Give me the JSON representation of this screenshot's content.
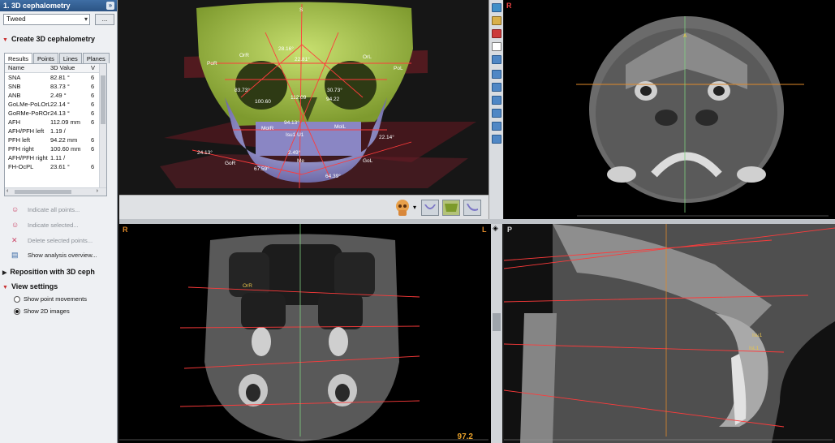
{
  "panel": {
    "title": "1. 3D cephalometry",
    "collapse_icon": "double-chevron-up",
    "analysis_select": "Tweed",
    "more_button": "...",
    "section_create": "Create 3D cephalometry",
    "tabs": [
      "Results",
      "Points",
      "Lines",
      "Planes"
    ],
    "active_tab": "Results",
    "table": {
      "headers": [
        "Name",
        "3D Value",
        "V"
      ],
      "rows": [
        {
          "name": "SNA",
          "value": "82.81 °",
          "v": "6"
        },
        {
          "name": "SNB",
          "value": "83.73 °",
          "v": "6"
        },
        {
          "name": "ANB",
          "value": "2.49 °",
          "v": "6"
        },
        {
          "name": "GoLMe-PoLOrL",
          "value": "22.14 °",
          "v": "6"
        },
        {
          "name": "GoRMe-PoROrR",
          "value": "24.13 °",
          "v": "6"
        },
        {
          "name": "AFH",
          "value": "112.09 mm",
          "v": "6"
        },
        {
          "name": "AFH/PFH left",
          "value": "1.19 /",
          "v": ""
        },
        {
          "name": "PFH left",
          "value": "94.22 mm",
          "v": "6"
        },
        {
          "name": "PFH right",
          "value": "100.60 mm",
          "v": "6"
        },
        {
          "name": "AFH/PFH right",
          "value": "1.11 /",
          "v": ""
        },
        {
          "name": "FH-OcPL",
          "value": "23.61 °",
          "v": "6"
        }
      ]
    },
    "actions": {
      "indicate_all": "Indicate all points...",
      "indicate_selected": "Indicate selected...",
      "delete_selected": "Delete selected points...",
      "show_overview": "Show analysis overview..."
    },
    "section_reposition": "Reposition with 3D ceph",
    "section_view": "View settings",
    "radio_point_movements": "Show point movements",
    "radio_2d_images": "Show 2D images",
    "radio_selected": "Show 2D images"
  },
  "view3d": {
    "labels": {
      "porL": "PoR",
      "orR": "OrR",
      "orL": "OrL",
      "poL": "PoL",
      "s": "S",
      "n": "N",
      "m": "28.16°",
      "a": "22.81°",
      "c": "83.73°",
      "d": "30.73°",
      "e": "100.60",
      "f": "112.09",
      "g": "94.22",
      "h": "94.13°",
      "molR": "MolR",
      "molL": "MolL",
      "isup": "Isu1 U1",
      "ang1": "24.13°",
      "ang2": "22.14°",
      "ang3": "2.49°",
      "goR": "GoR",
      "goL": "GoL",
      "ang4": "67.59°",
      "ang5": "64.39°",
      "me": "Me"
    }
  },
  "axial": {
    "orientation": "R",
    "point_a": "A"
  },
  "coronal": {
    "left_label": "R",
    "right_label": "L",
    "orR": "OrR",
    "zoom": "97.2"
  },
  "sagittal": {
    "orientation": "P",
    "isu1": "Isu1",
    "isl1": "IsL1"
  }
}
